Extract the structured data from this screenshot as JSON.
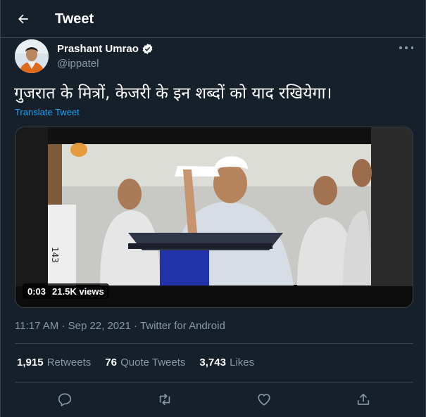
{
  "header": {
    "title": "Tweet",
    "back_icon": "arrow-left-icon"
  },
  "tweet": {
    "author": {
      "display_name": "Prashant Umrao",
      "handle": "@ippatel",
      "verified": true
    },
    "text": "गुजरात के मित्रों, केजरी के इन शब्दों को याद रखियेगा।",
    "translate_label": "Translate Tweet",
    "media": {
      "duration": "0:03",
      "views": "21.5K views"
    },
    "timestamp": "11:17 AM · Sep 22, 2021 · Twitter for Android",
    "stats": {
      "retweets_count": "1,915",
      "retweets_label": "Retweets",
      "quotes_count": "76",
      "quotes_label": "Quote Tweets",
      "likes_count": "3,743",
      "likes_label": "Likes"
    }
  },
  "actions": [
    "reply-icon",
    "retweet-icon",
    "like-icon",
    "share-icon"
  ],
  "colors": {
    "background": "#15202b",
    "border": "#38444d",
    "muted": "#8899a6",
    "accent": "#1da1f2"
  }
}
